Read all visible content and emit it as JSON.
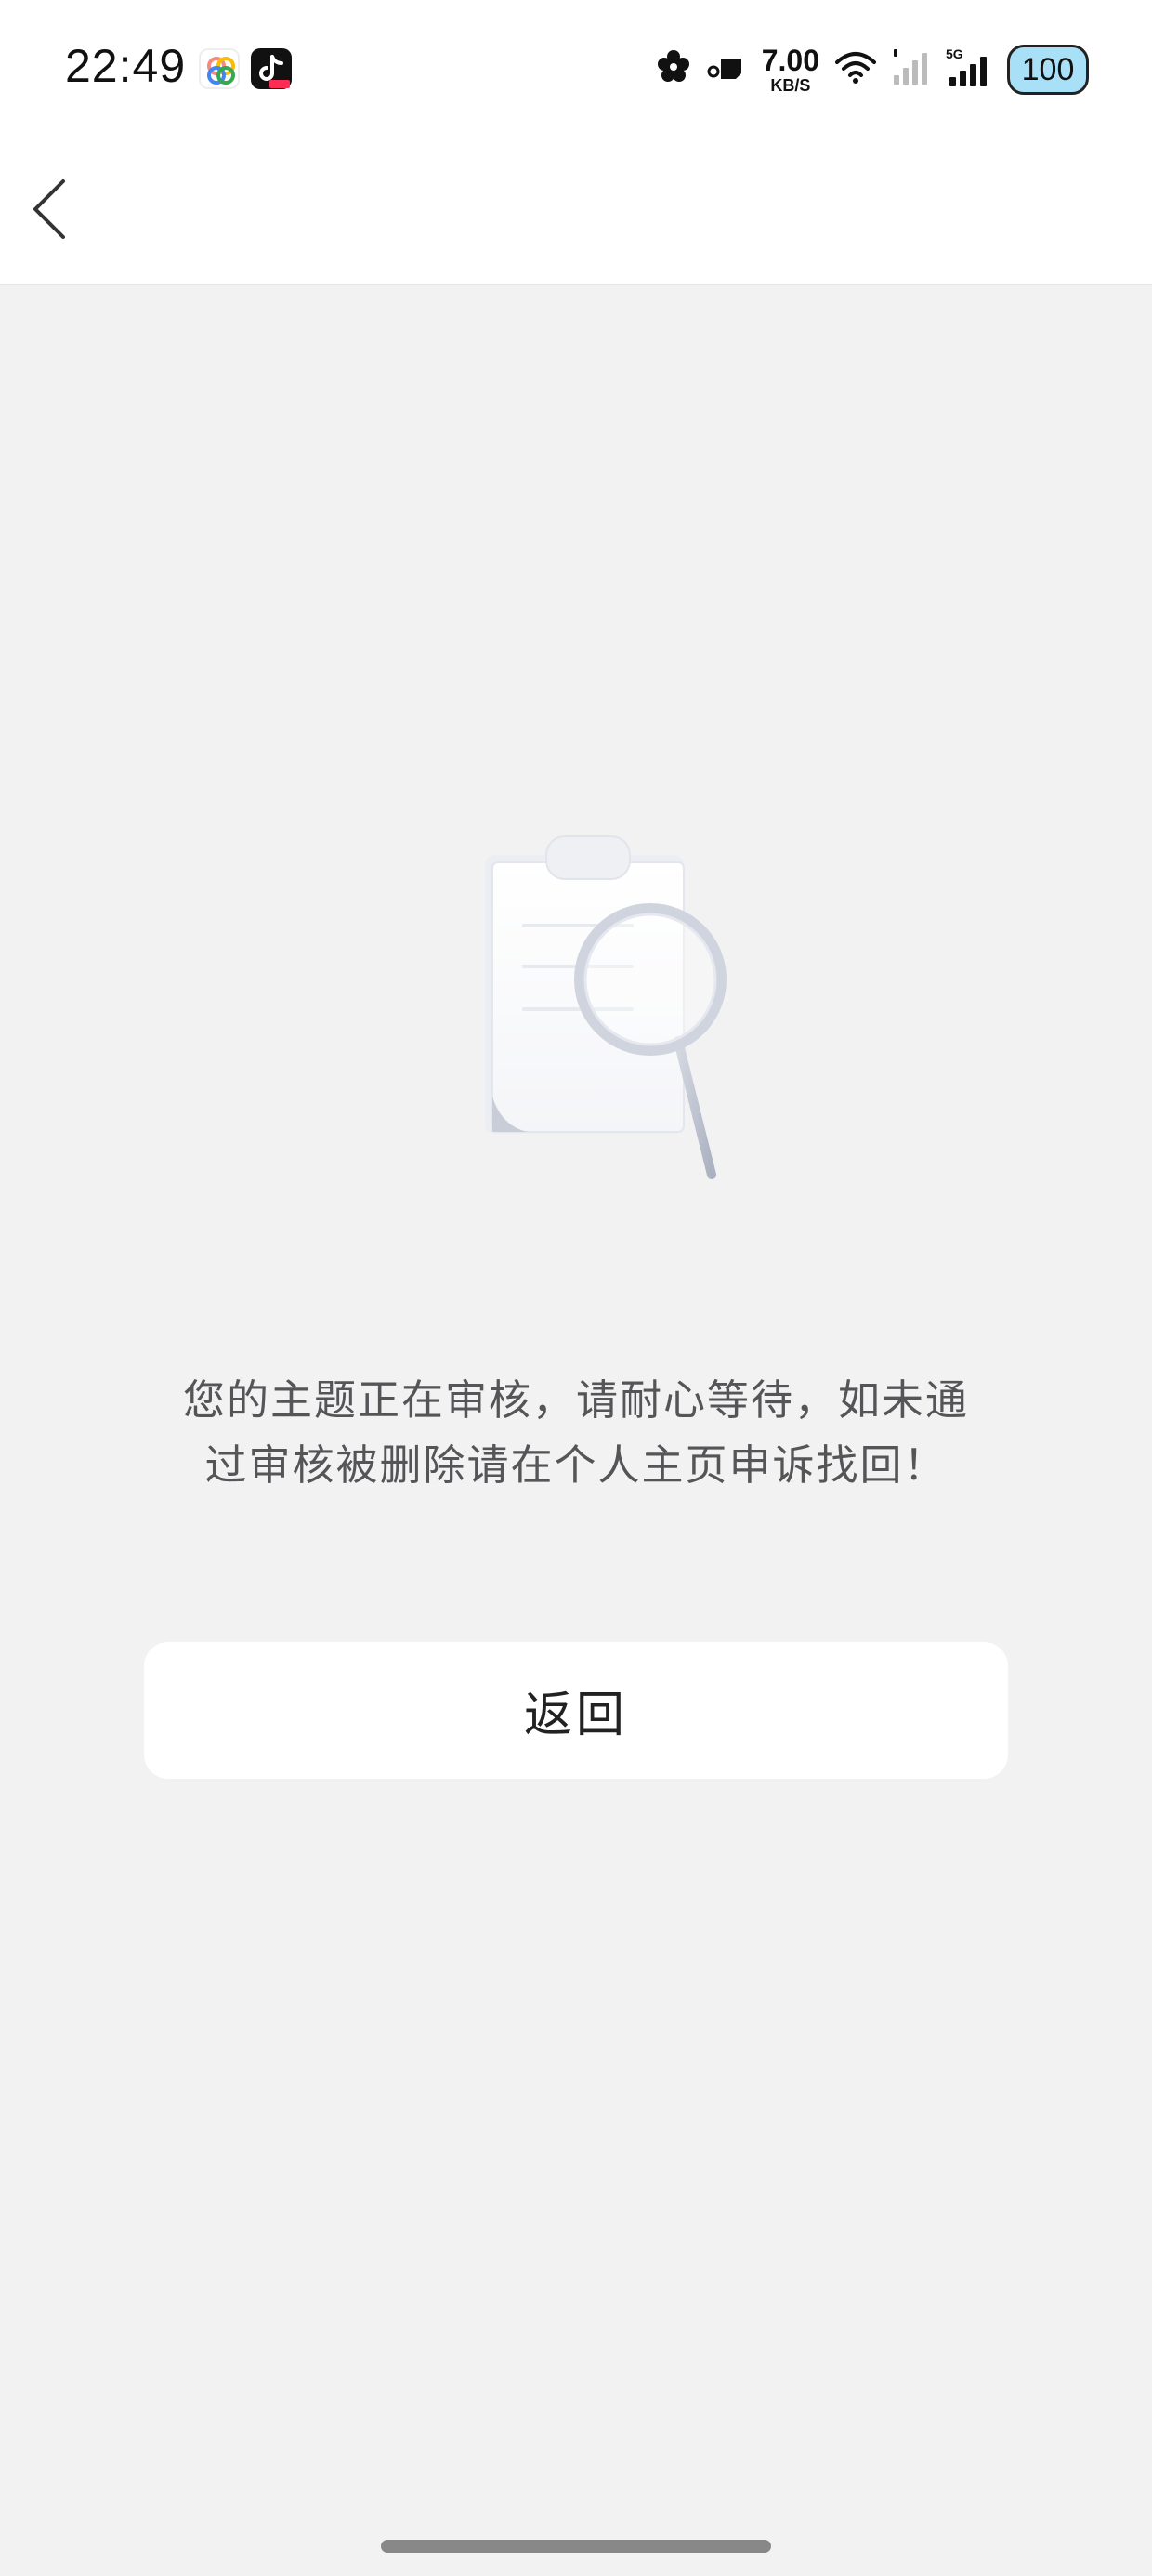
{
  "status_bar": {
    "time": "22:49",
    "net_speed_value": "7.00",
    "net_speed_unit": "KB/S",
    "network_label": "5G",
    "battery": "100"
  },
  "nav": {
    "back_icon": "chevron-left-icon"
  },
  "content": {
    "illustration": "document-search-illustration",
    "message": "您的主题正在审核，请耐心等待，如未通过审核被删除请在个人主页申诉找回！",
    "back_button_label": "返回"
  },
  "colors": {
    "background": "#f2f2f3",
    "surface": "#ffffff",
    "text_primary": "#222222",
    "text_secondary": "#555558",
    "battery_fill": "#a8e0f7"
  }
}
